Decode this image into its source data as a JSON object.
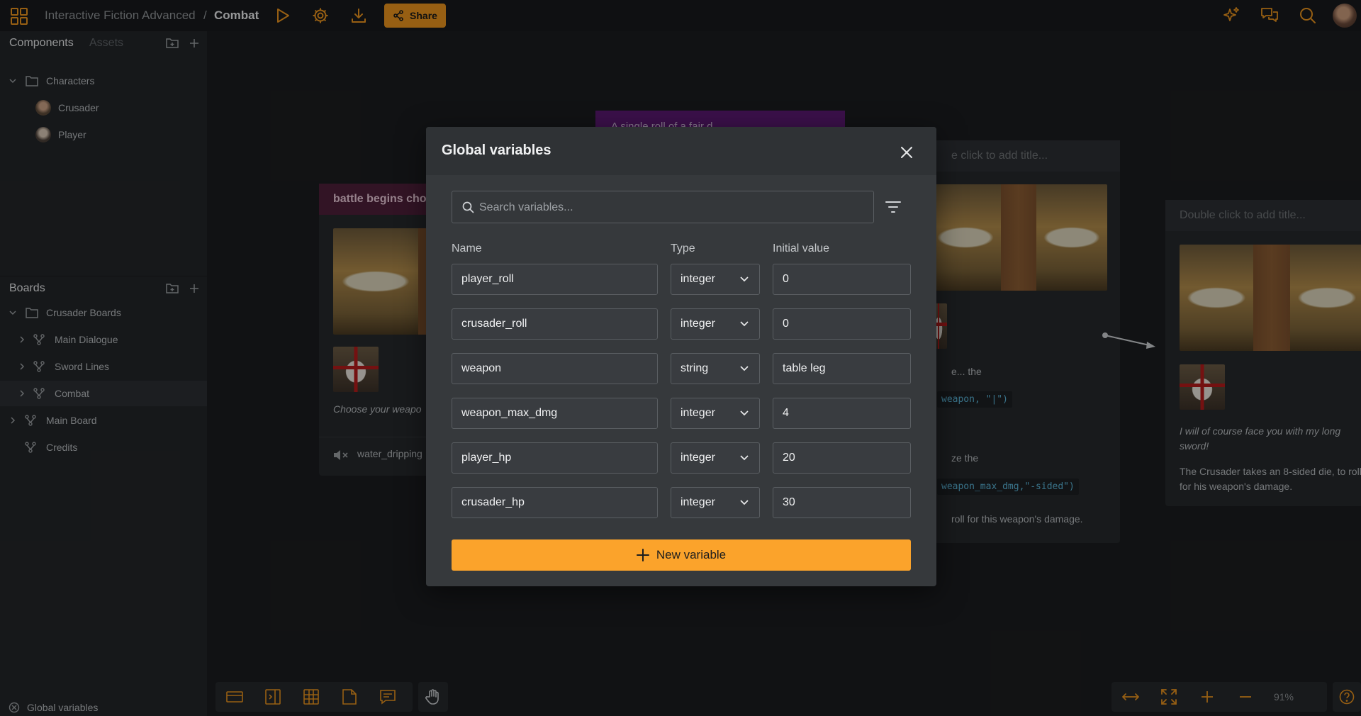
{
  "topbar": {
    "project": "Interactive Fiction Advanced",
    "separator": "/",
    "board": "Combat",
    "share_label": "Share"
  },
  "sidebar": {
    "components_tab": "Components",
    "assets_tab": "Assets",
    "characters_folder": "Characters",
    "characters": [
      "Crusader",
      "Player"
    ],
    "boards_title": "Boards",
    "boards_folder": "Crusader Boards",
    "sub_boards": [
      "Main Dialogue",
      "Sword Lines",
      "Combat"
    ],
    "main_board": "Main Board",
    "credits": "Credits",
    "footer_label": "Global variables"
  },
  "canvas": {
    "node1_title": "battle begins cho",
    "node1_text": "Choose your weapo",
    "node1_audio": "water_dripping",
    "node2_title": "e click to add title...",
    "node2_text1": "e... the",
    "node2_code1": "weapon, \"|\")",
    "node2_text2": "ze the",
    "node2_code2": "weapon_max_dmg,\"-sided\")",
    "node2_text3": "roll for this weapon's damage.",
    "node3_title": "Double click to add title...",
    "node3_quote": "I will of course face you with my long sword!",
    "node3_text": "The Crusader takes an 8-sided die, to roll for his weapon's damage.",
    "purple_text": "A single roll of a fair d",
    "zoom": "91%"
  },
  "modal": {
    "title": "Global variables",
    "search_placeholder": "Search variables...",
    "col_name": "Name",
    "col_type": "Type",
    "col_initial": "Initial value",
    "variables": [
      {
        "name": "player_roll",
        "type": "integer",
        "value": "0"
      },
      {
        "name": "crusader_roll",
        "type": "integer",
        "value": "0"
      },
      {
        "name": "weapon",
        "type": "string",
        "value": "table leg"
      },
      {
        "name": "weapon_max_dmg",
        "type": "integer",
        "value": "4"
      },
      {
        "name": "player_hp",
        "type": "integer",
        "value": "20"
      },
      {
        "name": "crusader_hp",
        "type": "integer",
        "value": "30"
      }
    ],
    "new_variable_label": "New variable"
  },
  "colors": {
    "accent": "#fba32b",
    "share": "#e8931e",
    "node1_header": "#4d1f3a",
    "purple": "#5b1a72",
    "code": "#59b3d6"
  }
}
